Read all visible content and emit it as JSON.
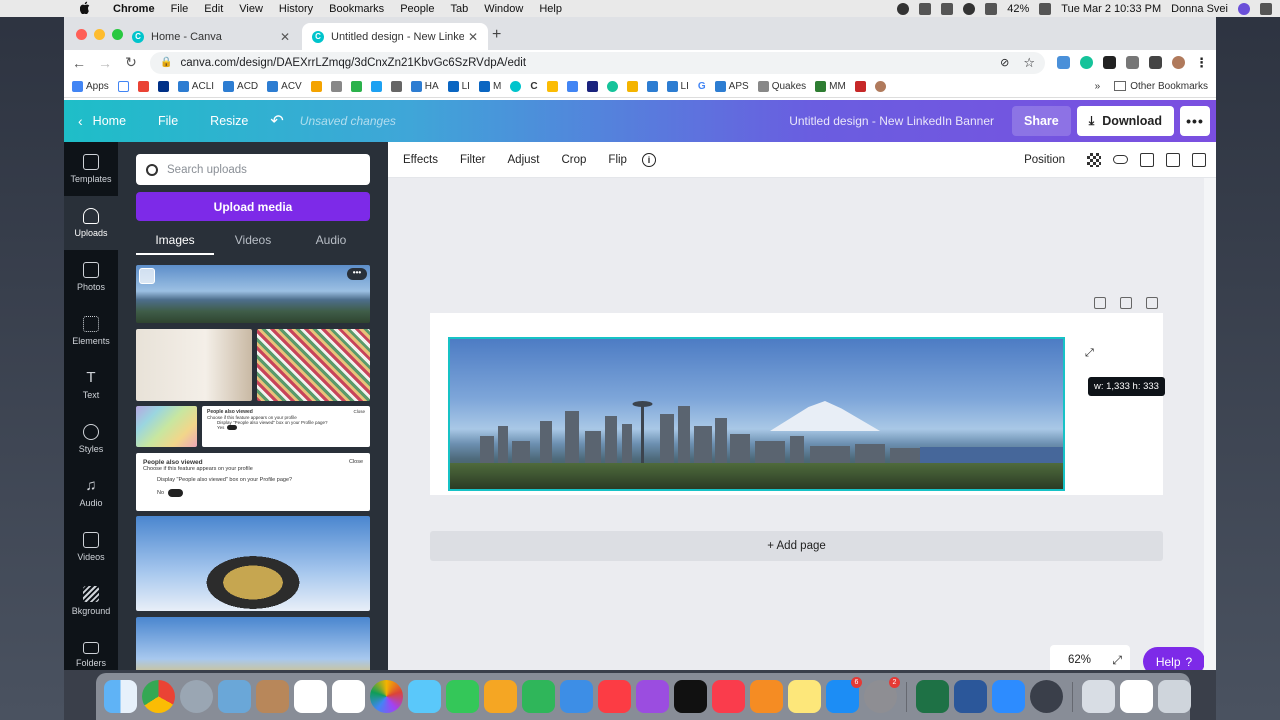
{
  "menubar": {
    "app": "Chrome",
    "menus": [
      "File",
      "Edit",
      "View",
      "History",
      "Bookmarks",
      "People",
      "Tab",
      "Window",
      "Help"
    ],
    "battery": "42%",
    "datetime": "Tue Mar 2  10:33 PM",
    "user": "Donna Svei"
  },
  "browser": {
    "tabs": [
      {
        "label": "Home - Canva"
      },
      {
        "label": "Untitled design - New LinkedIn"
      }
    ],
    "url": "canva.com/design/DAEXrrLZmqg/3dCnxZn21KbvGc6SzRVdpA/edit",
    "bookmarks": [
      "Apps",
      "2",
      "M",
      "P",
      "ACLI",
      "ACD",
      "ACV",
      "",
      "",
      "",
      "",
      "",
      "HA",
      "LI",
      "M",
      "",
      "C",
      "",
      "",
      "",
      "",
      "",
      "",
      "LI",
      "G",
      "APS",
      "Quakes",
      "MM",
      "",
      ""
    ],
    "other_bookmarks": "Other Bookmarks"
  },
  "canva_header": {
    "home": "Home",
    "file": "File",
    "resize": "Resize",
    "unsaved": "Unsaved changes",
    "doc_title": "Untitled design - New LinkedIn Banner",
    "share": "Share",
    "download": "Download",
    "more": "•••"
  },
  "rail": [
    {
      "label": "Templates",
      "icon": "templates-icon"
    },
    {
      "label": "Uploads",
      "icon": "upload-cloud-icon"
    },
    {
      "label": "Photos",
      "icon": "photo-icon"
    },
    {
      "label": "Elements",
      "icon": "elements-icon"
    },
    {
      "label": "Text",
      "icon": "text-icon"
    },
    {
      "label": "Styles",
      "icon": "palette-icon"
    },
    {
      "label": "Audio",
      "icon": "music-note-icon"
    },
    {
      "label": "Videos",
      "icon": "video-icon"
    },
    {
      "label": "Bkground",
      "icon": "background-icon"
    },
    {
      "label": "Folders",
      "icon": "folder-icon"
    }
  ],
  "panel": {
    "search_placeholder": "Search uploads",
    "upload_button": "Upload media",
    "tabs": [
      "Images",
      "Videos",
      "Audio"
    ],
    "thumb_card_title": "People also viewed",
    "thumb_card_sub": "Choose if this feature appears on your profile",
    "thumb_card_q": "Display \"People also viewed\" box on your Profile page?",
    "thumb_card_close": "Close",
    "thumb_card_no": "No",
    "thumb_card_yes": "Yes"
  },
  "toolbar": {
    "items": [
      "Effects",
      "Filter",
      "Adjust",
      "Crop",
      "Flip"
    ],
    "info": "i",
    "position": "Position"
  },
  "canvas": {
    "dimensions": "w: 1,333 h: 333",
    "add_page": "+ Add page",
    "zoom": "62%",
    "help": "Help",
    "help_q": "?"
  },
  "colors": {
    "accent_purple": "#7d2ae8",
    "selection_teal": "#17c2c6",
    "header_gradient_start": "#1ebec8",
    "header_gradient_end": "#7b4fe0"
  }
}
